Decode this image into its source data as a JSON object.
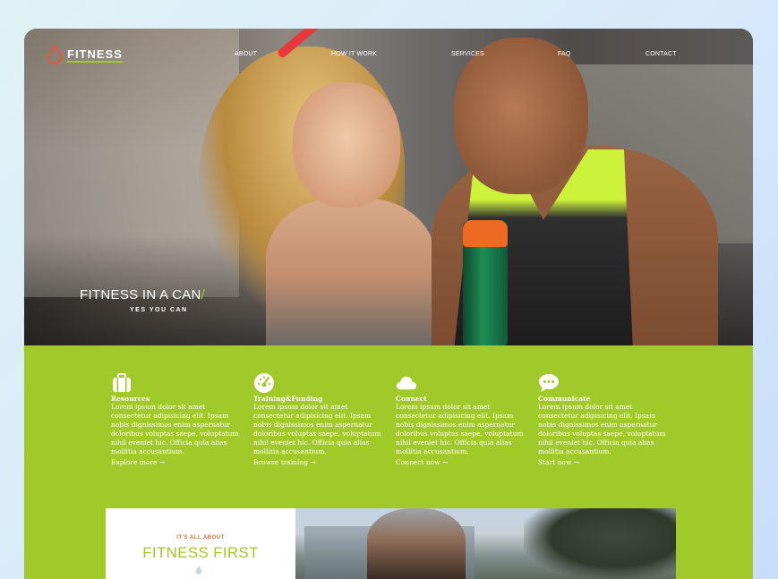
{
  "brand": {
    "name": "FITNESS",
    "accent": "#a2c92a",
    "drop_color": "#e8553b"
  },
  "nav": {
    "items": [
      "ABOUT",
      "HOW IT WORK",
      "SERVICES",
      "FAQ",
      "CONTACT"
    ]
  },
  "hero": {
    "headline": "FITNESS IN A CAN",
    "slash": "/",
    "subline": "YES YOU CAN"
  },
  "features": [
    {
      "icon": "suitcase-icon",
      "title": "Resources",
      "body": "Lorem ipsum dolor sit amet consectetur adipisicing elit. Ipsam nobis dignissimos enim aspernatur doloribus voluptas saepe, voluptatum nihil eveniet hic. Officia quia alias mollitia accusantium.",
      "link": "Explore more →"
    },
    {
      "icon": "dashboard-icon",
      "title": "Training&Funding",
      "body": "Lorem ipsum dolor sit amet consectetur adipisicing elit. Ipsam nobis dignissimos enim aspernatur doloribus voluptas saepe, voluptatum nihil eveniet hic. Officia quia alias mollitia accusantium.",
      "link": "Browse training →"
    },
    {
      "icon": "cloud-icon",
      "title": "Connect",
      "body": "Lorem ipsum dolor sit amet consectetur adipisicing elit. Ipsam nobis dignissimos enim aspernatur doloribus voluptas saepe, voluptatum nihil eveniet hic. Officia quia alias mollitia accusantium.",
      "link": "Connect now →"
    },
    {
      "icon": "chat-icon",
      "title": "Communicate",
      "body": "Lorem ipsum dolor sit amet consectetur adipisicing elit. Ipsam nobis dignissimos enim aspernatur doloribus voluptas saepe, voluptatum nihil eveniet hic. Officia quia alias mollitia accusantium.",
      "link": "Start now →"
    }
  ],
  "about": {
    "subtitle": "IT'S ALL ABOUT",
    "title": "FITNESS FIRST"
  }
}
